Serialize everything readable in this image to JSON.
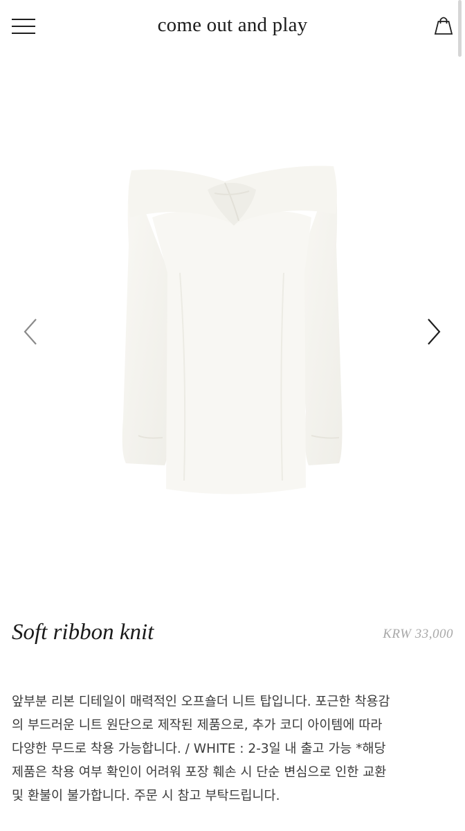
{
  "header": {
    "brand": "come out and play",
    "menu_icon": "hamburger-menu-icon",
    "cart_icon": "shopping-bag-icon"
  },
  "gallery": {
    "prev_icon": "chevron-left-icon",
    "next_icon": "chevron-right-icon",
    "image_subject": "white off-shoulder ribbon knit top"
  },
  "product": {
    "title": "Soft ribbon knit",
    "price": "KRW 33,000",
    "description_lines": [
      "앞부분 리본 디테일이 매력적인 오프숄더 니트 탑입니다. 포근한 착용감",
      "의 부드러운 니트 원단으로 제작된 제품으로, 추가 코디 아이템에 따라",
      "다양한 무드로 착용 가능합니다. / WHITE : 2-3일 내 출고 가능 *해당",
      "제품은 착용 여부 확인이 어려워 포장 훼손 시 단순 변심으로 인한 교환",
      "및 환불이 불가합니다. 주문 시 참고 부탁드립니다."
    ]
  },
  "colors": {
    "text": "#3a3a3a",
    "price": "#a8a8a8",
    "garment": "#f7f6f1"
  }
}
